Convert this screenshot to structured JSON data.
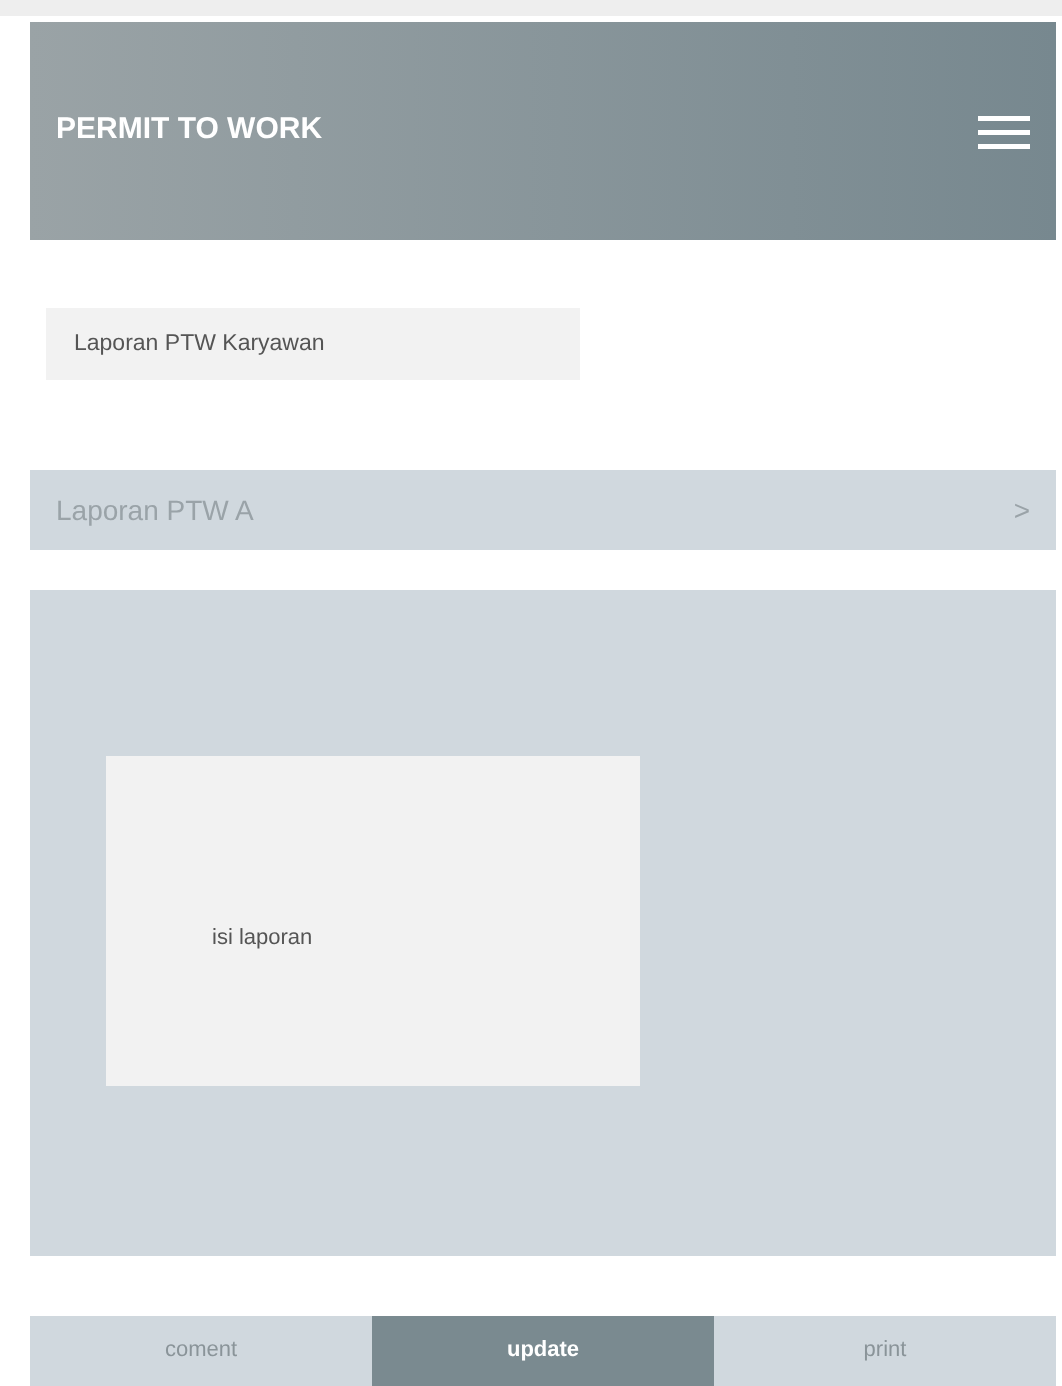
{
  "header": {
    "title": "PERMIT TO WORK"
  },
  "report_field": {
    "value": "Laporan PTW Karyawan"
  },
  "accordion": {
    "title": "Laporan PTW A",
    "chevron": ">",
    "content": "isi laporan"
  },
  "tabs": [
    {
      "label": "coment",
      "selected": false
    },
    {
      "label": "update",
      "selected": true
    },
    {
      "label": "print",
      "selected": false
    }
  ]
}
